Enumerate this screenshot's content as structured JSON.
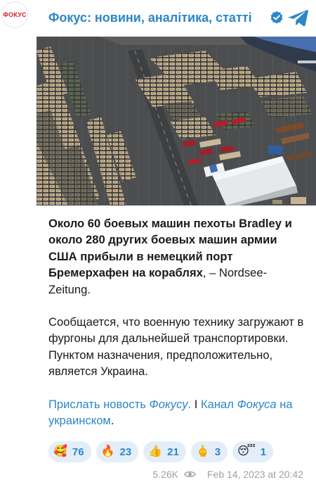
{
  "avatar": {
    "label": "ФОКУС"
  },
  "header": {
    "channel_name": "Фокус: новини, аналітика, статті",
    "verified_icon": "verified-badge-icon",
    "app_icon": "telegram-icon"
  },
  "photo": {
    "description": "Aerial photo of military vehicles at a port"
  },
  "post": {
    "paragraph1_bold": "Около 60 боевых машин пехоты Bradley и около 280 других боевых машин армии США прибыли в немецкий порт Бремерхафен на кораблях",
    "paragraph1_tail": ", – Nordsee-Zeitung.",
    "paragraph2": "Сообщается, что военную технику загружают в фургоны для дальнейшей транспортировки. Пунктом назначения, предположительно, является Украина.",
    "link1_pre": "Прислать новость ",
    "link1_italic": "Фокусу",
    "link1_post": ".",
    "separator": " I ",
    "link2_pre": "Канал ",
    "link2_italic": "Фокуса",
    "link2_post": " на украинском",
    "link2_tail": "."
  },
  "reactions": [
    {
      "emoji": "🥰",
      "count": "76"
    },
    {
      "emoji": "🔥",
      "count": "23"
    },
    {
      "emoji": "👍",
      "count": "21"
    },
    {
      "emoji": "🖕",
      "count": "3"
    },
    {
      "emoji": "😴",
      "count": "1"
    }
  ],
  "footer": {
    "views": "5.26K",
    "timestamp": "Feb 14, 2023 at 20:42"
  },
  "colors": {
    "accent": "#2c86c7",
    "brand": "#d5202a",
    "reaction_bg": "#e4eef8"
  }
}
